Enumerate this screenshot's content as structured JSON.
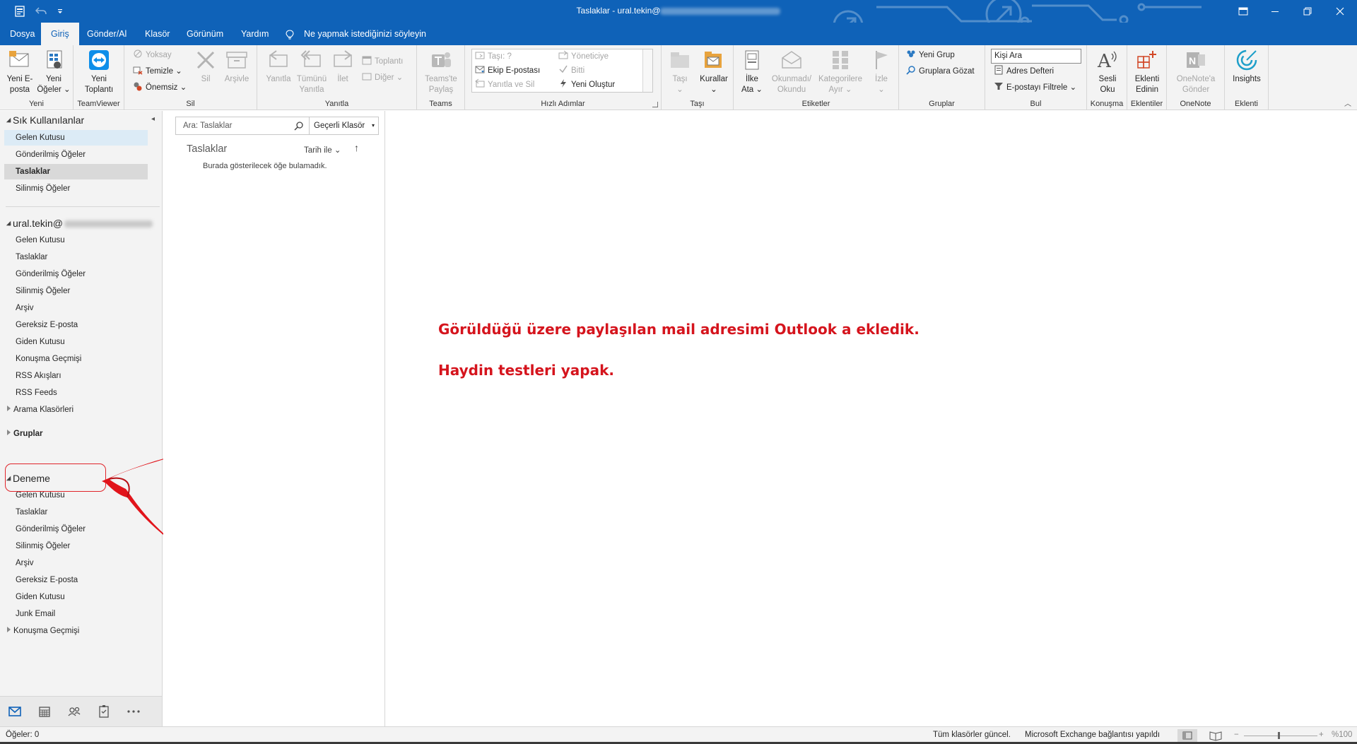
{
  "window": {
    "title_prefix": "Taslaklar - ural.tekin@"
  },
  "quick_access": {
    "app_icon": "outlook-icon",
    "undo_icon": "undo-icon",
    "customize_icon": "customize-qat-icon"
  },
  "menu": {
    "tabs": [
      "Dosya",
      "Giriş",
      "Gönder/Al",
      "Klasör",
      "Görünüm",
      "Yardım"
    ],
    "active_tab": "Giriş",
    "tell_me": "Ne yapmak istediğinizi söyleyin"
  },
  "ribbon": {
    "groups": {
      "yeni": "Yeni",
      "teamviewer": "TeamViewer",
      "sil": "Sil",
      "yanitla": "Yanıtla",
      "teams": "Teams",
      "hizli_adimlar": "Hızlı Adımlar",
      "tasi": "Taşı",
      "etiketler": "Etiketler",
      "gruplar": "Gruplar",
      "bul": "Bul",
      "konusma": "Konuşma",
      "eklentiler": "Eklentiler",
      "onenote": "OneNote",
      "eklenti": "Eklenti"
    },
    "yeni_eposta": [
      "Yeni E-",
      "posta"
    ],
    "yeni_ogeler": [
      "Yeni",
      "Öğeler"
    ],
    "yeni_toplanti": [
      "Yeni",
      "Toplantı"
    ],
    "yoksay": "Yoksay",
    "temizle": "Temizle",
    "onemsiz": "Önemsiz",
    "sil": "Sil",
    "arsivle": "Arşivle",
    "yanitla": "Yanıtla",
    "tumunu_yanitla": [
      "Tümünü",
      "Yanıtla"
    ],
    "ilet": "İlet",
    "toplanti": "Toplantı",
    "diger": "Diğer",
    "teams_paylas": [
      "Teams'te",
      "Paylaş"
    ],
    "quick_steps": {
      "tasi": "Taşı: ?",
      "ekip_epostasi": "Ekip E-postası",
      "yanitla_ve_sil": "Yanıtla ve Sil",
      "yoneticiye": "Yöneticiye",
      "bitti": "Bitti",
      "yeni_olustur": "Yeni Oluştur"
    },
    "tasi_btn": "Taşı",
    "kurallar": "Kurallar",
    "ilke_ata": [
      "İlke",
      "Ata"
    ],
    "okunmadi_okundu": [
      "Okunmadı/",
      "Okundu"
    ],
    "kategorilere_ayir": [
      "Kategorilere",
      "Ayır"
    ],
    "izle": "İzle",
    "yeni_grup": "Yeni Grup",
    "gruplara_gozat": "Gruplara Gözat",
    "kisi_ara": "Kişi Ara",
    "adres_defteri": "Adres Defteri",
    "eposta_filtrele": "E-postayı Filtrele",
    "sesli_oku": [
      "Sesli",
      "Oku"
    ],
    "eklenti_edinin": [
      "Eklenti",
      "Edinin"
    ],
    "onenote_gonder": [
      "OneNote'a",
      "Gönder"
    ],
    "insights": "Insights"
  },
  "folders": {
    "favorites_header": "Sık Kullanılanlar",
    "favorites": [
      "Gelen Kutusu",
      "Gönderilmiş Öğeler",
      "Taslaklar",
      "Silinmiş Öğeler"
    ],
    "account_header": "ural.tekin@",
    "account_items": [
      "Gelen Kutusu",
      "Taslaklar",
      "Gönderilmiş Öğeler",
      "Silinmiş Öğeler",
      "Arşiv",
      "Gereksiz E-posta",
      "Giden Kutusu",
      "Konuşma Geçmişi",
      "RSS Akışları",
      "RSS Feeds",
      "Arama Klasörleri"
    ],
    "groups_header": "Gruplar",
    "shared_header": "Deneme",
    "shared_items": [
      "Gelen Kutusu",
      "Taslaklar",
      "Gönderilmiş Öğeler",
      "Silinmiş Öğeler",
      "Arşiv",
      "Gereksiz E-posta",
      "Giden Kutusu",
      "Junk Email",
      "Konuşma Geçmişi"
    ]
  },
  "message_list": {
    "search_placeholder": "Ara: Taslaklar",
    "scope": "Geçerli Klasör",
    "title": "Taslaklar",
    "sort_by": "Tarih ile",
    "empty_text": "Burada gösterilecek öğe bulamadık."
  },
  "reading_pane": {
    "annotation_line1": "Görüldüğü üzere paylaşılan mail adresimi Outlook a ekledik.",
    "annotation_line2": "Haydin testleri yapak."
  },
  "status_bar": {
    "items_count": "Öğeler: 0",
    "folders_status": "Tüm klasörler güncel.",
    "connection": "Microsoft Exchange bağlantısı yapıldı",
    "zoom": "%100"
  },
  "colors": {
    "brand_blue": "#0f62b8",
    "annotation_red": "#d5141d",
    "ribbon_bg": "#f3f3f3"
  }
}
